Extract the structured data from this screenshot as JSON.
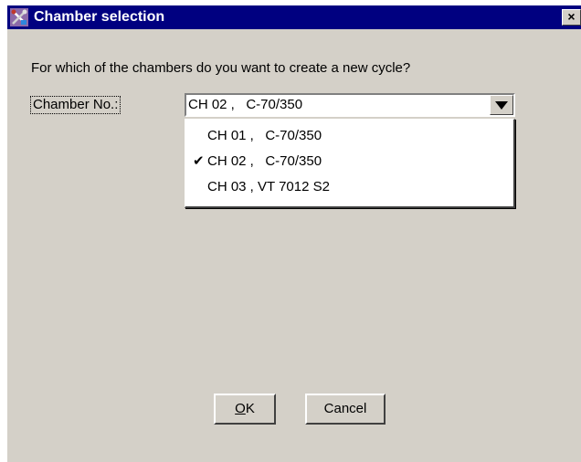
{
  "window": {
    "title": "Chamber selection",
    "app_icon": "tools-icon",
    "close_label": "×"
  },
  "prompt_text": "For which of the chambers do you want to create a new cycle?",
  "chamber_field": {
    "label": "Chamber No.:",
    "selected_value": "CH 02 ,   C-70/350",
    "dropdown_icon": "triangle-down-icon",
    "options": [
      {
        "label": "CH 01 ,   C-70/350",
        "checked": false
      },
      {
        "label": "CH 02 ,   C-70/350",
        "checked": true
      },
      {
        "label": "CH 03 , VT 7012 S2",
        "checked": false
      }
    ],
    "check_glyph": "✔"
  },
  "buttons": {
    "ok_mnemonic": "O",
    "ok_rest": "K",
    "cancel_label": "Cancel"
  },
  "colors": {
    "titlebar": "#000080",
    "dialog_face": "#d4d0c8",
    "field_background": "#ffffff"
  }
}
